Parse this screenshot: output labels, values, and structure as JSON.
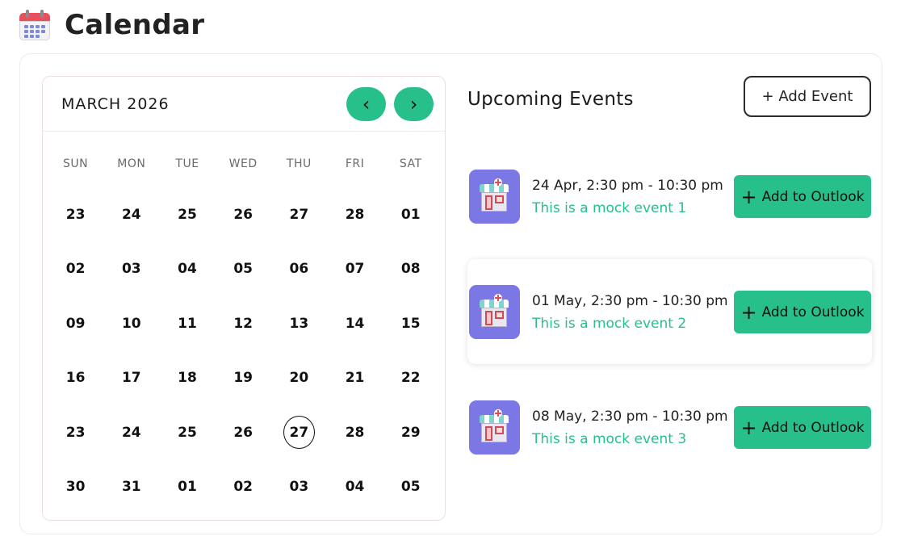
{
  "page": {
    "title": "Calendar",
    "icon": "calendar-icon"
  },
  "calendar": {
    "month_label": "MARCH 2026",
    "prev_icon": "chevron-left-icon",
    "next_icon": "chevron-right-icon",
    "prev_glyph": "‹",
    "next_glyph": "›",
    "weekdays": [
      "SUN",
      "MON",
      "TUE",
      "WED",
      "THU",
      "FRI",
      "SAT"
    ],
    "days": [
      "23",
      "24",
      "25",
      "26",
      "27",
      "28",
      "01",
      "02",
      "03",
      "04",
      "05",
      "06",
      "07",
      "08",
      "09",
      "10",
      "11",
      "12",
      "13",
      "14",
      "15",
      "16",
      "17",
      "18",
      "19",
      "20",
      "21",
      "22",
      "23",
      "24",
      "25",
      "26",
      "27",
      "28",
      "29",
      "30",
      "31",
      "01",
      "02",
      "03",
      "04",
      "05"
    ],
    "today": "27"
  },
  "events": {
    "title": "Upcoming Events",
    "add_button": "+ Add Event",
    "outlook_label": "Add to Outlook",
    "outlook_plus": "+",
    "accent": "#27c08a",
    "items": [
      {
        "time": "24 Apr, 2:30 pm - 10:30 pm",
        "name": "This is a mock event 1",
        "icon": "store-icon"
      },
      {
        "time": "01 May, 2:30 pm - 10:30 pm",
        "name": "This is a mock event 2",
        "icon": "store-icon"
      },
      {
        "time": "08 May, 2:30 pm - 10:30 pm",
        "name": "This is a mock event 3",
        "icon": "store-icon"
      }
    ]
  }
}
